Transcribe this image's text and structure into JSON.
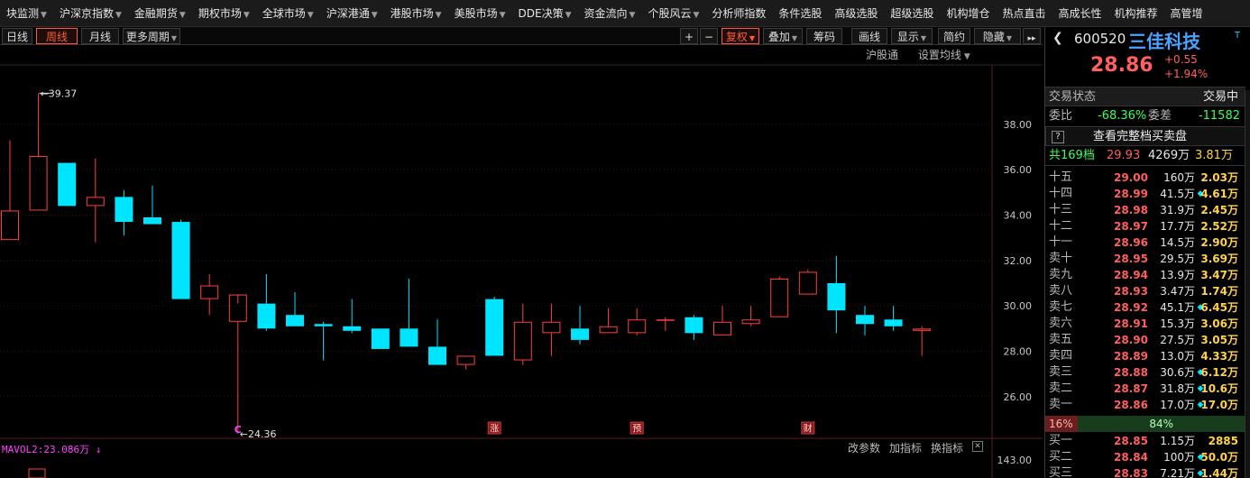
{
  "menu": [
    {
      "label": "块监测",
      "arrow": true
    },
    {
      "label": "沪深京指数",
      "arrow": true
    },
    {
      "label": "金融期货",
      "arrow": true
    },
    {
      "label": "期权市场",
      "arrow": true
    },
    {
      "label": "全球市场",
      "arrow": true
    },
    {
      "label": "沪深港通",
      "arrow": true
    },
    {
      "label": "港股市场",
      "arrow": true
    },
    {
      "label": "美股市场",
      "arrow": true
    },
    {
      "label": "DDE决策",
      "arrow": true
    },
    {
      "label": "资金流向",
      "arrow": true
    },
    {
      "label": "个股风云",
      "arrow": true
    },
    {
      "label": "分析师指数",
      "arrow": false
    },
    {
      "label": "条件选股",
      "arrow": false
    },
    {
      "label": "高级选股",
      "arrow": false
    },
    {
      "label": "超级选股",
      "arrow": false
    },
    {
      "label": "机构增仓",
      "arrow": false
    },
    {
      "label": "热点直击",
      "arrow": false
    },
    {
      "label": "高成长性",
      "arrow": false
    },
    {
      "label": "机构推荐",
      "arrow": false
    },
    {
      "label": "高管增",
      "arrow": false
    }
  ],
  "toolbar": {
    "daily": "日线",
    "weekly": "周线",
    "monthly": "月线",
    "more_period": "更多周期",
    "plus": "+",
    "minus": "−",
    "adjust": "复权",
    "overlay": "叠加",
    "chips": "筹码",
    "draw": "画线",
    "display": "显示",
    "simple": "简约",
    "hide": "隐藏",
    "expand": "▸▸"
  },
  "subbar": {
    "hgt": "沪股通",
    "ma_settings": "设置均线"
  },
  "colors": {
    "up": "#ff4040",
    "down": "#00e5ff",
    "accent": "#ff5b3a",
    "bg": "#000000",
    "grid": "#2a1a1a"
  },
  "chart_data": {
    "type": "candlestick",
    "period": "weekly",
    "y_ticks": [
      "38.00",
      "36.00",
      "34.00",
      "32.00",
      "30.00",
      "28.00",
      "26.00"
    ],
    "ylim": [
      24.8,
      39.9
    ],
    "candles": [
      {
        "o": 32.9,
        "h": 37.3,
        "l": 32.9,
        "c": 34.2
      },
      {
        "o": 34.2,
        "h": 39.37,
        "l": 34.2,
        "c": 36.6
      },
      {
        "o": 36.3,
        "h": 36.3,
        "l": 34.4,
        "c": 34.4
      },
      {
        "o": 34.4,
        "h": 36.5,
        "l": 32.8,
        "c": 34.8
      },
      {
        "o": 34.8,
        "h": 35.1,
        "l": 33.1,
        "c": 33.7
      },
      {
        "o": 33.9,
        "h": 35.3,
        "l": 33.6,
        "c": 33.6
      },
      {
        "o": 33.7,
        "h": 33.8,
        "l": 30.3,
        "c": 30.3
      },
      {
        "o": 30.3,
        "h": 31.4,
        "l": 29.6,
        "c": 30.9
      },
      {
        "o": 29.3,
        "h": 30.1,
        "l": 24.36,
        "c": 30.5
      },
      {
        "o": 30.1,
        "h": 31.4,
        "l": 28.9,
        "c": 29.0
      },
      {
        "o": 29.6,
        "h": 30.6,
        "l": 29.1,
        "c": 29.1
      },
      {
        "o": 29.2,
        "h": 29.3,
        "l": 27.6,
        "c": 29.1
      },
      {
        "o": 29.1,
        "h": 30.3,
        "l": 28.8,
        "c": 28.9
      },
      {
        "o": 29.0,
        "h": 29.0,
        "l": 28.1,
        "c": 28.1
      },
      {
        "o": 29.0,
        "h": 31.2,
        "l": 28.2,
        "c": 28.2
      },
      {
        "o": 28.2,
        "h": 29.4,
        "l": 27.4,
        "c": 27.4
      },
      {
        "o": 27.4,
        "h": 27.8,
        "l": 27.2,
        "c": 27.8
      },
      {
        "o": 30.3,
        "h": 30.4,
        "l": 27.8,
        "c": 27.8
      },
      {
        "o": 27.6,
        "h": 30.1,
        "l": 27.4,
        "c": 29.3
      },
      {
        "o": 28.8,
        "h": 30.1,
        "l": 27.8,
        "c": 29.3
      },
      {
        "o": 29.0,
        "h": 30.0,
        "l": 28.3,
        "c": 28.5
      },
      {
        "o": 28.8,
        "h": 29.9,
        "l": 28.8,
        "c": 29.1
      },
      {
        "o": 28.8,
        "h": 29.9,
        "l": 28.7,
        "c": 29.4
      },
      {
        "o": 29.4,
        "h": 29.5,
        "l": 28.9,
        "c": 29.4
      },
      {
        "o": 29.5,
        "h": 29.6,
        "l": 28.5,
        "c": 28.8
      },
      {
        "o": 28.7,
        "h": 30.0,
        "l": 28.7,
        "c": 29.3
      },
      {
        "o": 29.2,
        "h": 30.0,
        "l": 29.1,
        "c": 29.4
      },
      {
        "o": 29.5,
        "h": 31.3,
        "l": 29.5,
        "c": 31.2
      },
      {
        "o": 30.5,
        "h": 31.6,
        "l": 30.5,
        "c": 31.5
      },
      {
        "o": 31.0,
        "h": 32.2,
        "l": 28.8,
        "c": 29.8
      },
      {
        "o": 29.6,
        "h": 30.0,
        "l": 28.7,
        "c": 29.2
      },
      {
        "o": 29.4,
        "h": 30.0,
        "l": 28.9,
        "c": 29.1
      },
      {
        "o": 28.9,
        "h": 29.1,
        "l": 27.8,
        "c": 29.0
      }
    ],
    "annotations": {
      "high_label": "39.37",
      "low_label": "24.36"
    },
    "markers": [
      {
        "index": 8,
        "text": "C",
        "color": "#ff44ff",
        "style": "plain"
      },
      {
        "index": 17,
        "text": "涨",
        "color": "#ff5f5f",
        "style": "box"
      },
      {
        "index": 22,
        "text": "预",
        "color": "#ff5f5f",
        "style": "box"
      },
      {
        "index": 28,
        "text": "财",
        "color": "#ff5f5f",
        "style": "box"
      }
    ],
    "volume": {
      "label": "MAVOL2:23.086万 ↓",
      "axis_value": "143.00"
    }
  },
  "vol_tools": {
    "change_params": "改参数",
    "add_indicator": "加指标",
    "switch_indicator": "换指标",
    "close": "✕"
  },
  "stock": {
    "back": "❮",
    "code": "600520",
    "name": "三佳科技",
    "tag": "T",
    "price": "28.86",
    "change": "+0.55",
    "change_pct": "+1.94%"
  },
  "status": {
    "label": "交易状态",
    "value": "交易中",
    "wb_label": "委比",
    "wb_value": "-68.36%",
    "wc_label": "委差",
    "wc_value": "-11582",
    "full_icon": "?",
    "full_book": "查看完整档买卖盘",
    "total_label": "共169档",
    "total_price": "29.93",
    "total_amount": "4269万",
    "total_volume": "3.81万"
  },
  "order_book": [
    {
      "label": "十五",
      "price": "29.00",
      "vol": "160万",
      "dot": "",
      "sum": "2.03万"
    },
    {
      "label": "十四",
      "price": "28.99",
      "vol": "41.5万",
      "dot": "◆",
      "sum": "4.61万"
    },
    {
      "label": "十三",
      "price": "28.98",
      "vol": "31.9万",
      "dot": "",
      "sum": "2.45万"
    },
    {
      "label": "十二",
      "price": "28.97",
      "vol": "17.7万",
      "dot": "",
      "sum": "2.52万"
    },
    {
      "label": "十一",
      "price": "28.96",
      "vol": "14.5万",
      "dot": "",
      "sum": "2.90万"
    },
    {
      "label": "卖十",
      "price": "28.95",
      "vol": "29.5万",
      "dot": "",
      "sum": "3.69万"
    },
    {
      "label": "卖九",
      "price": "28.94",
      "vol": "13.9万",
      "dot": "",
      "sum": "3.47万"
    },
    {
      "label": "卖八",
      "price": "28.93",
      "vol": "3.47万",
      "dot": "",
      "sum": "1.74万"
    },
    {
      "label": "卖七",
      "price": "28.92",
      "vol": "45.1万",
      "dot": "◆",
      "sum": "6.45万"
    },
    {
      "label": "卖六",
      "price": "28.91",
      "vol": "15.3万",
      "dot": "",
      "sum": "3.06万"
    },
    {
      "label": "卖五",
      "price": "28.90",
      "vol": "27.5万",
      "dot": "",
      "sum": "3.05万"
    },
    {
      "label": "卖四",
      "price": "28.89",
      "vol": "13.0万",
      "dot": "",
      "sum": "4.33万"
    },
    {
      "label": "卖三",
      "price": "28.88",
      "vol": "30.6万",
      "dot": "◆",
      "sum": "6.12万"
    },
    {
      "label": "卖二",
      "price": "28.87",
      "vol": "31.8万",
      "dot": "◆",
      "sum": "10.6万"
    },
    {
      "label": "卖一",
      "price": "28.86",
      "vol": "17.0万",
      "dot": "◆",
      "sum": "17.0万"
    }
  ],
  "ratio": {
    "left": "16%",
    "right": "84%",
    "left_fraction": 0.16
  },
  "buy_book": [
    {
      "label": "买一",
      "price": "28.85",
      "vol": "1.15万",
      "dot": "",
      "sum": "2885"
    },
    {
      "label": "买二",
      "price": "28.84",
      "vol": "100万",
      "dot": "◆",
      "sum": "50.0万"
    },
    {
      "label": "买三",
      "price": "28.83",
      "vol": "7.21万",
      "dot": "◆",
      "sum": "1.44万"
    }
  ]
}
